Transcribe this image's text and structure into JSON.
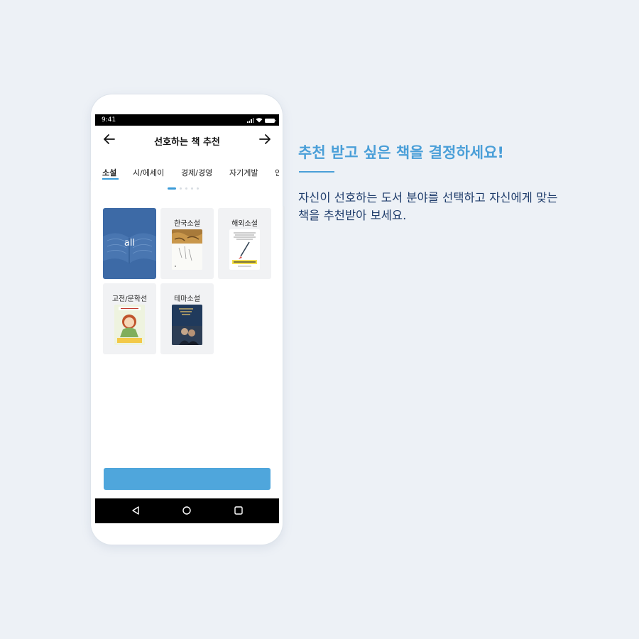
{
  "status_bar": {
    "time": "9:41"
  },
  "header": {
    "title": "선호하는 책 추천",
    "back_icon": "arrow-left-icon",
    "next_icon": "arrow-right-icon"
  },
  "tabs": [
    {
      "label": "소설",
      "active": true
    },
    {
      "label": "시/에세이",
      "active": false
    },
    {
      "label": "경제/경영",
      "active": false
    },
    {
      "label": "자기계발",
      "active": false
    },
    {
      "label": "인",
      "active": false
    }
  ],
  "pager": {
    "count": 5,
    "active_index": 0
  },
  "categories": [
    {
      "label": "all",
      "selected": true
    },
    {
      "label": "한국소설",
      "selected": false
    },
    {
      "label": "해외소설",
      "selected": false
    },
    {
      "label": "고전/문학선",
      "selected": false
    },
    {
      "label": "테마소설",
      "selected": false
    }
  ],
  "colors": {
    "accent": "#4a9fd8",
    "button": "#4fa6dc",
    "selected_card": "#3d6aa6",
    "description": "#1e3c6b"
  },
  "side_text": {
    "headline": "추천 받고 싶은 책을 결정하세요!",
    "description": "자신이 선호하는 도서 분야를 선택하고 자신에게 맞는\n 책을 추천받아 보세요."
  }
}
